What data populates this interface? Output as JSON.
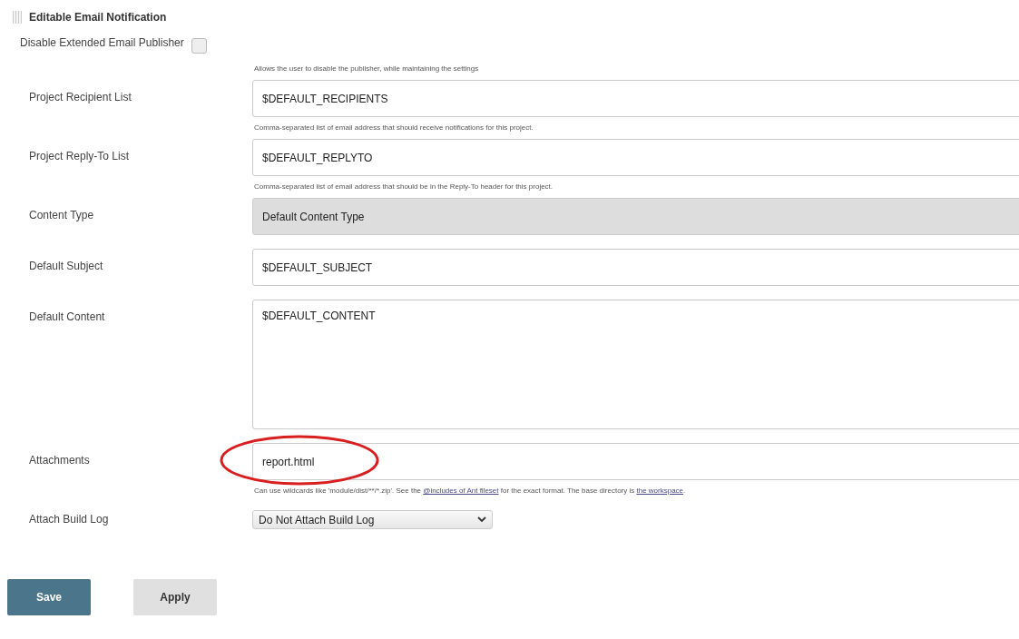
{
  "section": {
    "title": "Editable Email Notification"
  },
  "disable": {
    "label": "Disable Extended Email Publisher",
    "checked": false,
    "help": "Allows the user to disable the publisher, while maintaining the settings"
  },
  "fields": [
    {
      "kind": "text",
      "label": "Project Recipient List",
      "value": "$DEFAULT_RECIPIENTS",
      "help": [
        {
          "text": "Comma-separated list of email address that should receive notifications for this project."
        }
      ]
    },
    {
      "kind": "text",
      "label": "Project Reply-To List",
      "value": "$DEFAULT_REPLYTO",
      "help": [
        {
          "text": "Comma-separated list of email address that should be in the Reply-To header for this project."
        }
      ]
    },
    {
      "kind": "readonly",
      "label": "Content Type",
      "value": "Default Content Type"
    },
    {
      "kind": "text",
      "label": "Default Subject",
      "value": "$DEFAULT_SUBJECT"
    },
    {
      "kind": "textarea",
      "label": "Default Content",
      "value": "$DEFAULT_CONTENT"
    },
    {
      "kind": "text",
      "label": "Attachments",
      "value": "report.html",
      "highlighted": true,
      "help": [
        {
          "text": "Can use wildcards like 'module/dist/**/*.zip'. See the "
        },
        {
          "link": "@includes of Ant fileset"
        },
        {
          "text": " for the exact format. The base directory is "
        },
        {
          "link": "the workspace"
        },
        {
          "text": "."
        }
      ]
    },
    {
      "kind": "select",
      "label": "Attach Build Log",
      "value": "Do Not Attach Build Log"
    }
  ],
  "buttons": [
    {
      "label": "Save",
      "primary": true
    },
    {
      "label": "Apply",
      "primary": false
    }
  ]
}
